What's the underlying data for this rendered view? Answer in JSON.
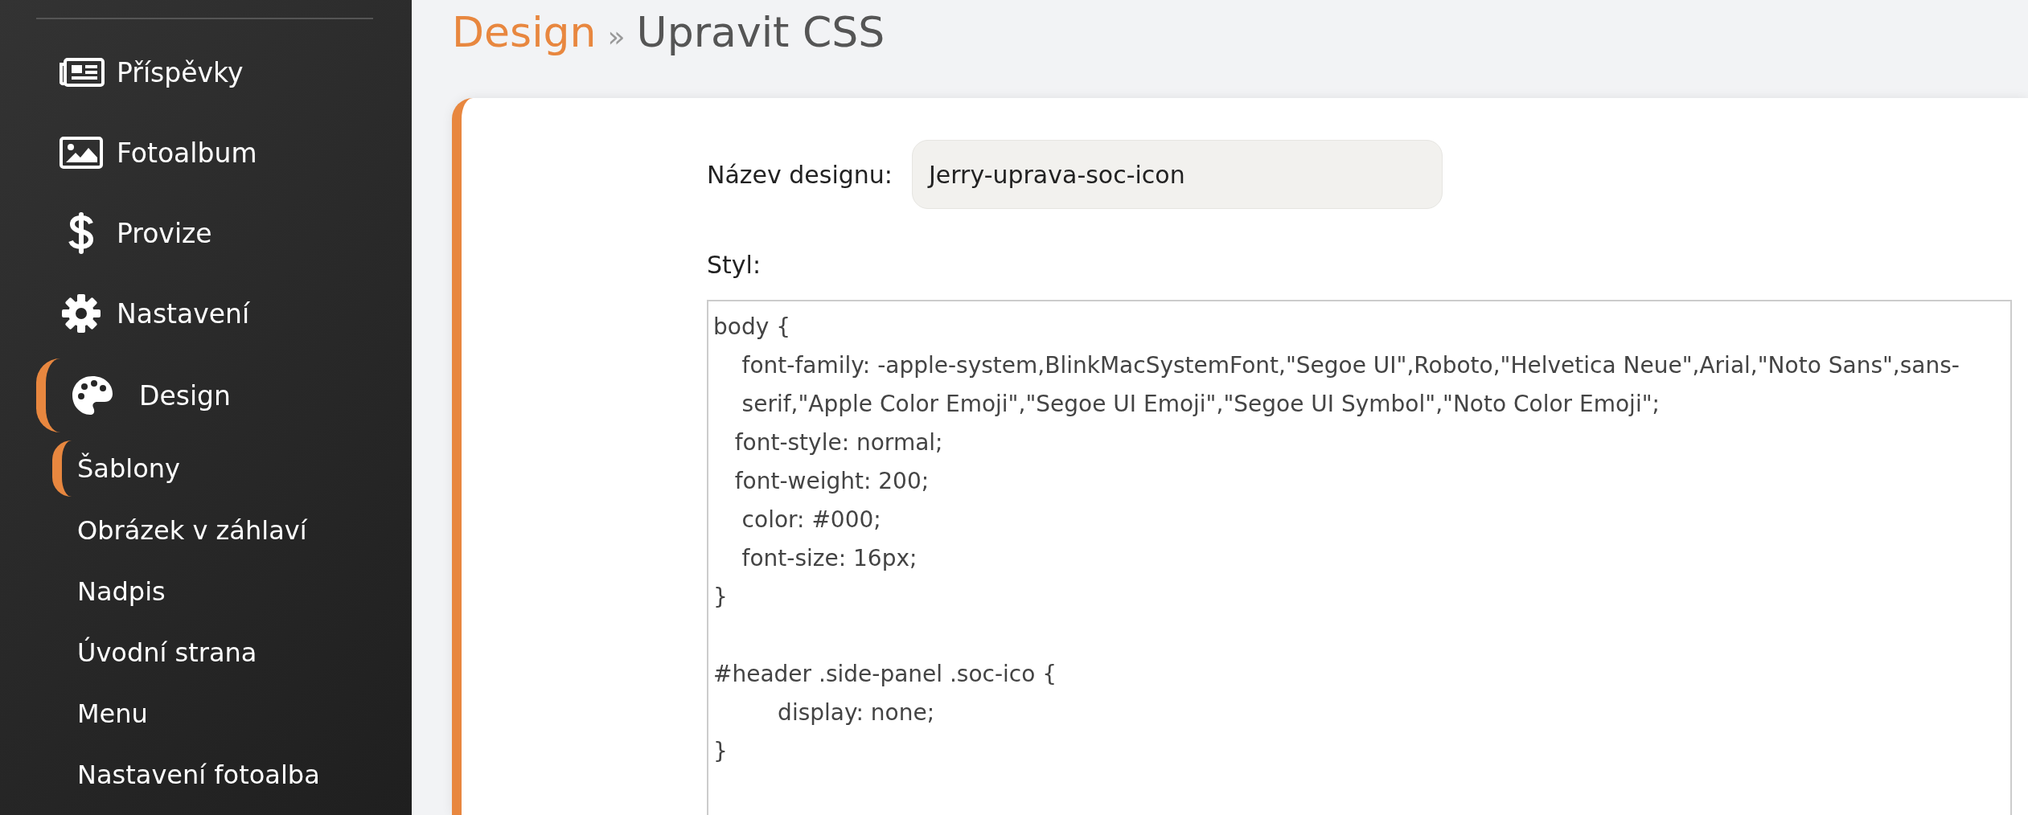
{
  "sidebar": {
    "items": [
      {
        "label": "Příspěvky",
        "kind": "newspaper",
        "selected": false
      },
      {
        "label": "Fotoalbum",
        "kind": "image",
        "selected": false
      },
      {
        "label": "Provize",
        "kind": "dollar",
        "selected": false
      },
      {
        "label": "Nastavení",
        "kind": "gear",
        "selected": false
      },
      {
        "label": "Design",
        "kind": "palette",
        "selected": true,
        "children": [
          {
            "label": "Šablony",
            "selected": true
          },
          {
            "label": "Obrázek v záhlaví",
            "selected": false
          },
          {
            "label": "Nadpis",
            "selected": false
          },
          {
            "label": "Úvodní strana",
            "selected": false
          },
          {
            "label": "Menu",
            "selected": false
          },
          {
            "label": "Nastavení fotoalba",
            "selected": false
          }
        ]
      }
    ]
  },
  "breadcrumb": {
    "parent": "Design",
    "separator": "»",
    "current": "Upravit CSS"
  },
  "form": {
    "name_label": "Název designu:",
    "name_value": "Jerry-uprava-soc-icon",
    "style_label": "Styl:",
    "style_blocks": [
      [
        "body {",
        "    font-family: -apple-system,BlinkMacSystemFont,\"Segoe UI\",Roboto,\"Helvetica Neue\",Arial,\"Noto Sans\",sans-serif,\"Apple Color Emoji\",\"Segoe UI Emoji\",\"Segoe UI Symbol\",\"Noto Color Emoji\";",
        "   font-style: normal;",
        "   font-weight: 200;",
        "    color: #000;",
        "    font-size: 16px;",
        "}"
      ],
      [
        "#header .side-panel .soc-ico {",
        "         display: none;",
        "}"
      ]
    ]
  }
}
